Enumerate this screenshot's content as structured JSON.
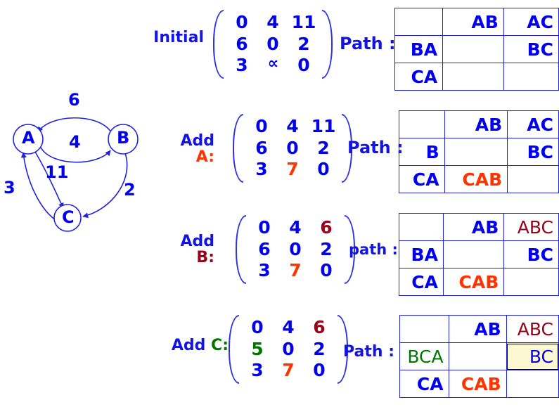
{
  "graph": {
    "nodes": [
      {
        "id": "A",
        "label": "A"
      },
      {
        "id": "B",
        "label": "B"
      },
      {
        "id": "C",
        "label": "C"
      }
    ],
    "edge_labels": [
      {
        "id": "BA",
        "label": "6"
      },
      {
        "id": "AB",
        "label": "4"
      },
      {
        "id": "AC",
        "label": "11"
      },
      {
        "id": "CA",
        "label": "3"
      },
      {
        "id": "BC",
        "label": "2"
      }
    ],
    "color": "#0000ee"
  },
  "colors": {
    "blue": "#0000ee",
    "orange": "#ff3300",
    "darkred": "#99001a",
    "green": "#007700",
    "highlight_bg": "#fcf8d2"
  },
  "steps": [
    {
      "caption_line1": "Initial",
      "caption_line2": "",
      "caption_accent": "",
      "path_label": "Path :",
      "matrix": [
        [
          {
            "v": "0",
            "c": "blue"
          },
          {
            "v": "4",
            "c": "blue"
          },
          {
            "v": "11",
            "c": "blue"
          }
        ],
        [
          {
            "v": "6",
            "c": "blue"
          },
          {
            "v": "0",
            "c": "blue"
          },
          {
            "v": "2",
            "c": "blue"
          }
        ],
        [
          {
            "v": "3",
            "c": "blue"
          },
          {
            "v": "∝",
            "c": "blue",
            "inf": true
          },
          {
            "v": "0",
            "c": "blue"
          }
        ]
      ],
      "table": [
        [
          {
            "v": "",
            "c": "blue"
          },
          {
            "v": "AB",
            "c": "blue"
          },
          {
            "v": "AC",
            "c": "blue"
          }
        ],
        [
          {
            "v": "BA",
            "c": "blue"
          },
          {
            "v": "",
            "c": "blue"
          },
          {
            "v": "BC",
            "c": "blue"
          }
        ],
        [
          {
            "v": "CA",
            "c": "blue"
          },
          {
            "v": "",
            "c": "blue"
          },
          {
            "v": "",
            "c": "blue"
          }
        ]
      ]
    },
    {
      "caption_line1": "Add",
      "caption_line2": "A:",
      "caption_accent": "orange",
      "path_label": "Path :",
      "matrix": [
        [
          {
            "v": "0",
            "c": "blue"
          },
          {
            "v": "4",
            "c": "blue"
          },
          {
            "v": "11",
            "c": "blue"
          }
        ],
        [
          {
            "v": "6",
            "c": "blue"
          },
          {
            "v": "0",
            "c": "blue"
          },
          {
            "v": "2",
            "c": "blue"
          }
        ],
        [
          {
            "v": "3",
            "c": "blue"
          },
          {
            "v": "7",
            "c": "orange"
          },
          {
            "v": "0",
            "c": "blue"
          }
        ]
      ],
      "table": [
        [
          {
            "v": "",
            "c": "blue"
          },
          {
            "v": "AB",
            "c": "blue"
          },
          {
            "v": "AC",
            "c": "blue"
          }
        ],
        [
          {
            "v": "B",
            "c": "blue"
          },
          {
            "v": "",
            "c": "blue"
          },
          {
            "v": "BC",
            "c": "blue"
          }
        ],
        [
          {
            "v": "CA",
            "c": "blue"
          },
          {
            "v": "CAB",
            "c": "orange"
          },
          {
            "v": "",
            "c": "blue"
          }
        ]
      ]
    },
    {
      "caption_line1": "Add",
      "caption_line2": "B:",
      "caption_accent": "darkred",
      "path_label": "path :",
      "matrix": [
        [
          {
            "v": "0",
            "c": "blue"
          },
          {
            "v": "4",
            "c": "blue"
          },
          {
            "v": "6",
            "c": "darkred"
          }
        ],
        [
          {
            "v": "6",
            "c": "blue"
          },
          {
            "v": "0",
            "c": "blue"
          },
          {
            "v": "2",
            "c": "blue"
          }
        ],
        [
          {
            "v": "3",
            "c": "blue"
          },
          {
            "v": "7",
            "c": "orange"
          },
          {
            "v": "0",
            "c": "blue"
          }
        ]
      ],
      "table": [
        [
          {
            "v": "",
            "c": "blue"
          },
          {
            "v": "AB",
            "c": "blue"
          },
          {
            "v": "ABC",
            "c": "darkred"
          }
        ],
        [
          {
            "v": "BA",
            "c": "blue"
          },
          {
            "v": "",
            "c": "blue"
          },
          {
            "v": "BC",
            "c": "blue"
          }
        ],
        [
          {
            "v": "CA",
            "c": "blue"
          },
          {
            "v": "CAB",
            "c": "orange"
          },
          {
            "v": "",
            "c": "blue"
          }
        ]
      ]
    },
    {
      "caption_line1": "Add C:",
      "caption_line2": "",
      "caption_accent": "green",
      "path_label": "Path :",
      "matrix": [
        [
          {
            "v": "0",
            "c": "blue"
          },
          {
            "v": "4",
            "c": "blue"
          },
          {
            "v": "6",
            "c": "darkred"
          }
        ],
        [
          {
            "v": "5",
            "c": "green"
          },
          {
            "v": "0",
            "c": "blue"
          },
          {
            "v": "2",
            "c": "blue"
          }
        ],
        [
          {
            "v": "3",
            "c": "blue"
          },
          {
            "v": "7",
            "c": "orange"
          },
          {
            "v": "0",
            "c": "blue"
          }
        ]
      ],
      "table": [
        [
          {
            "v": "",
            "c": "blue"
          },
          {
            "v": "AB",
            "c": "blue"
          },
          {
            "v": "ABC",
            "c": "darkred"
          }
        ],
        [
          {
            "v": "BCA",
            "c": "green"
          },
          {
            "v": "",
            "c": "blue"
          },
          {
            "v": "BC",
            "c": "blue",
            "highlight": true
          }
        ],
        [
          {
            "v": "CA",
            "c": "blue"
          },
          {
            "v": "CAB",
            "c": "orange"
          },
          {
            "v": "",
            "c": "blue"
          }
        ]
      ]
    }
  ]
}
